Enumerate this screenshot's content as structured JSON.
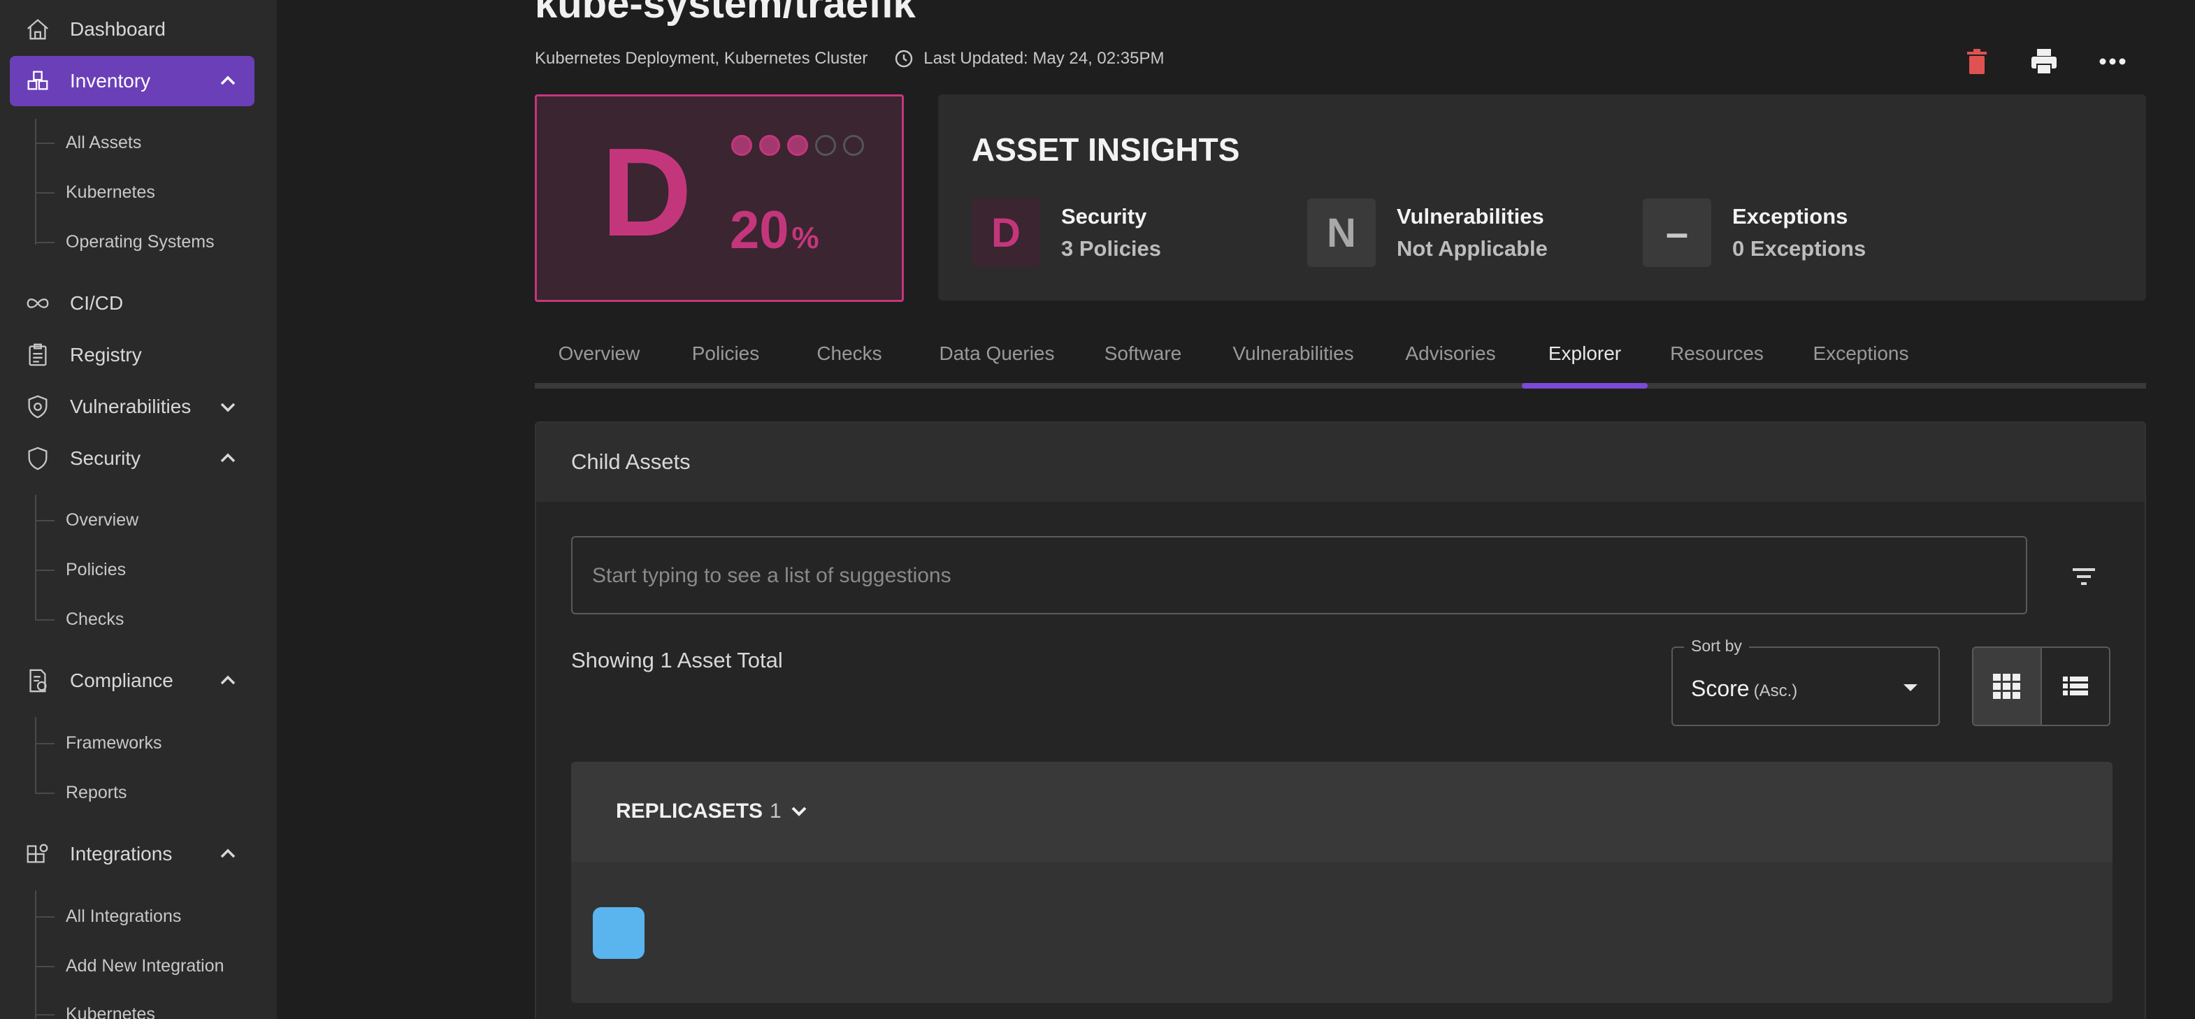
{
  "sidebar": {
    "dashboard": "Dashboard",
    "inventory": "Inventory",
    "inventory_items": [
      "All Assets",
      "Kubernetes",
      "Operating Systems"
    ],
    "cicd": "CI/CD",
    "registry": "Registry",
    "vulnerabilities": "Vulnerabilities",
    "security": "Security",
    "security_items": [
      "Overview",
      "Policies",
      "Checks"
    ],
    "compliance": "Compliance",
    "compliance_items": [
      "Frameworks",
      "Reports"
    ],
    "integrations": "Integrations",
    "integrations_items": [
      "All Integrations",
      "Add New Integration",
      "Kubernetes"
    ]
  },
  "header": {
    "title": "kube-system/traefik",
    "subtitle": "Kubernetes Deployment, Kubernetes Cluster",
    "last_updated": "Last Updated: May 24, 02:35PM"
  },
  "score": {
    "grade": "D",
    "value": "20",
    "unit": "%",
    "dots_filled": 3,
    "dots_total": 5,
    "accent": "#c4367c"
  },
  "insights": {
    "title": "ASSET INSIGHTS",
    "items": [
      {
        "badge": "D",
        "label": "Security",
        "value": "3 Policies"
      },
      {
        "badge": "N",
        "label": "Vulnerabilities",
        "value": "Not Applicable"
      },
      {
        "badge": "–",
        "label": "Exceptions",
        "value": "0 Exceptions"
      }
    ]
  },
  "tabs": [
    "Overview",
    "Policies",
    "Checks",
    "Data Queries",
    "Software",
    "Vulnerabilities",
    "Advisories",
    "Explorer",
    "Resources",
    "Exceptions"
  ],
  "active_tab": "Explorer",
  "child_assets": {
    "title": "Child Assets",
    "search_placeholder": "Start typing to see a list of suggestions",
    "showing": "Showing 1 Asset Total",
    "sort_label": "Sort by",
    "sort_value": "Score",
    "sort_order": "(Asc.)",
    "group_name": "REPLICASETS",
    "group_count": "1"
  },
  "colors": {
    "accent_purple": "#6b3fb8",
    "tab_underline": "#7b4ad6",
    "delete_red": "#e05252",
    "asset_tile": "#5ab4ee"
  }
}
